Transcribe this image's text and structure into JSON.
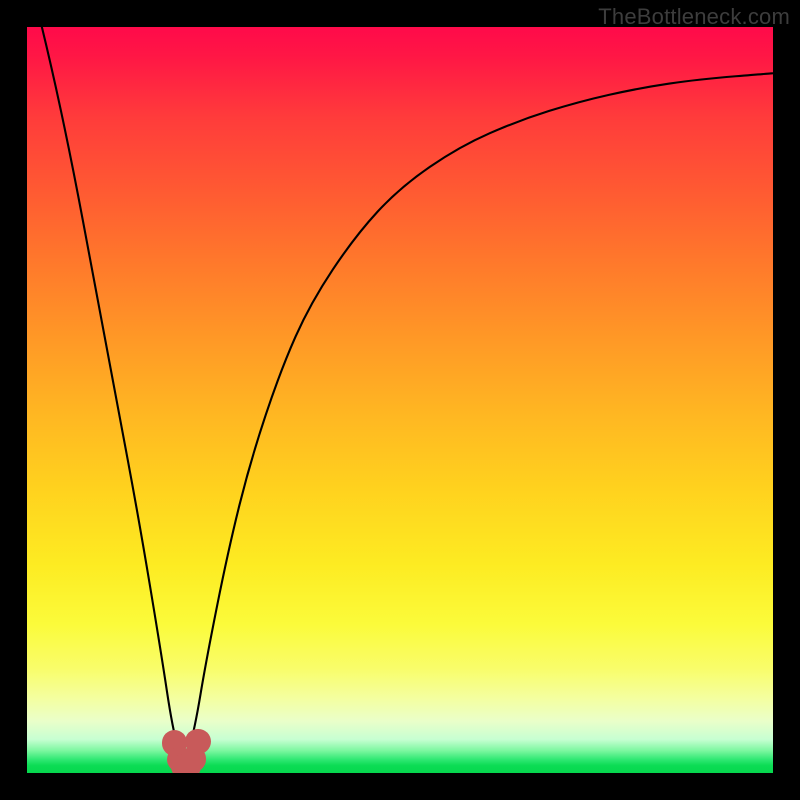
{
  "watermark": "TheBottleneck.com",
  "colors": {
    "frame": "#000000",
    "curve": "#000000",
    "marker": "#c85a5a"
  },
  "chart_data": {
    "type": "line",
    "title": "",
    "xlabel": "",
    "ylabel": "",
    "xlim": [
      0,
      100
    ],
    "ylim": [
      0,
      100
    ],
    "grid": false,
    "comment": "Values are approximate readings of the V-curve in percent of plot height (0 = bottom/green, 100 = top/red). Minimum at x≈21.",
    "x": [
      0,
      3,
      6,
      9,
      12,
      15,
      18,
      19.5,
      21,
      22.5,
      24,
      27,
      30,
      34,
      38,
      44,
      50,
      58,
      66,
      74,
      82,
      90,
      100
    ],
    "values": [
      108,
      96,
      82,
      66,
      50,
      34,
      16,
      6,
      0.5,
      6,
      15,
      30,
      42,
      54,
      63,
      72,
      78.5,
      84,
      87.5,
      90,
      91.8,
      93,
      93.8
    ],
    "markers": {
      "comment": "salmon dots near curve minimum, plot-percent coords",
      "points": [
        {
          "x": 19.8,
          "y": 4.0
        },
        {
          "x": 20.4,
          "y": 1.8
        },
        {
          "x": 21.0,
          "y": 0.9
        },
        {
          "x": 21.6,
          "y": 0.9
        },
        {
          "x": 22.3,
          "y": 1.9
        },
        {
          "x": 22.9,
          "y": 4.2
        }
      ],
      "radius_pct": 1.7
    }
  }
}
